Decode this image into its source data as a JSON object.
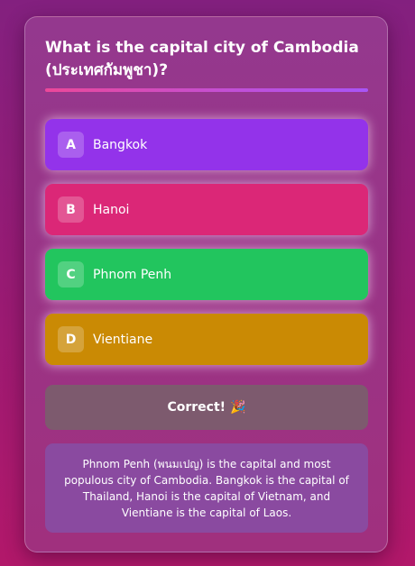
{
  "quiz": {
    "question": "What is the capital city of Cambodia (ประเทศกัมพูชา)?",
    "options": [
      {
        "letter": "A",
        "text": "Bangkok",
        "color": "#9333ea"
      },
      {
        "letter": "B",
        "text": "Hanoi",
        "color": "#db2777"
      },
      {
        "letter": "C",
        "text": "Phnom Penh",
        "color": "#22c55e"
      },
      {
        "letter": "D",
        "text": "Vientiane",
        "color": "#ca8a04"
      }
    ],
    "feedback": {
      "text": "Correct!",
      "emoji": "🎉"
    },
    "explanation": "Phnom Penh (พนมเปญ) is the capital and most populous city of Cambodia. Bangkok is the capital of Thailand, Hanoi is the capital of Vietnam, and Vientiane is the capital of Laos."
  },
  "colors": {
    "background": "#9a1a72",
    "card": "#94388e",
    "accent_gradient_start": "#ec4899",
    "accent_gradient_end": "#a855f7",
    "feedback_bg": "#7d5a6e",
    "explanation_bg": "#8a4aa0"
  }
}
